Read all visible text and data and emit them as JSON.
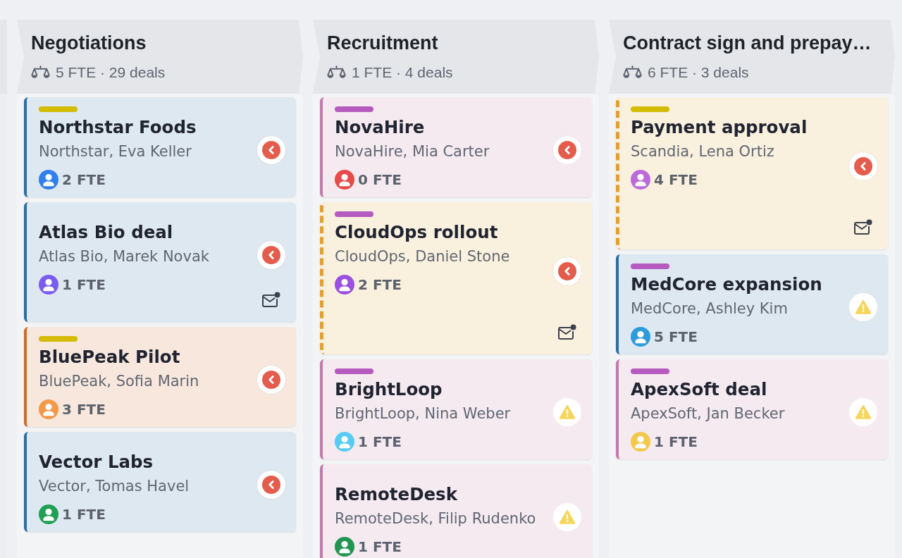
{
  "columns": [
    {
      "title": "Negotiations",
      "summary": "5 FTE · 29 deals",
      "cards": [
        {
          "title": "Northstar Foods",
          "contact": "Northstar, Eva Keller",
          "fte": "2 FTE",
          "color": "#2e6da4",
          "dashed": false,
          "tag": {
            "color": "#d4bc00"
          },
          "avatar": {
            "color": "#2f80ed"
          },
          "action": {
            "kind": "back"
          },
          "mail": false
        },
        {
          "title": "Atlas Bio deal",
          "contact": "Atlas Bio, Marek Novak",
          "fte": "1 FTE",
          "color": "#2e6da4",
          "dashed": false,
          "avatar": {
            "color": "#7b5cf0"
          },
          "action": {
            "kind": "back"
          },
          "mail": true
        },
        {
          "title": "BluePeak Pilot",
          "contact": "BluePeak, Sofia Marin",
          "fte": "3 FTE",
          "color": "#d0692a",
          "dashed": false,
          "tag": {
            "color": "#d4bc00"
          },
          "avatar": {
            "color": "#f2994a"
          },
          "action": {
            "kind": "back"
          },
          "mail": false
        },
        {
          "title": "Vector Labs",
          "contact": "Vector, Tomas Havel",
          "fte": "1 FTE",
          "color": "#2e6da4",
          "dashed": false,
          "avatar": {
            "color": "#1fa055"
          },
          "action": {
            "kind": "back"
          },
          "mail": false
        }
      ]
    },
    {
      "title": "Recruitment",
      "summary": "1 FTE · 4 deals",
      "cards": [
        {
          "title": "NovaHire",
          "contact": "NovaHire, Mia Carter",
          "fte": "0 FTE",
          "color": "#c47aa8",
          "dashed": false,
          "tag": {
            "color": "#b55bbf"
          },
          "avatar": {
            "color": "#e84a4a"
          },
          "action": {
            "kind": "back"
          },
          "mail": false
        },
        {
          "title": "CloudOps rollout",
          "contact": "CloudOps, Daniel Stone",
          "fte": "2 FTE",
          "color": "#e2a030",
          "dashed": true,
          "tag": {
            "color": "#b55bbf"
          },
          "avatar": {
            "color": "#9b51e0"
          },
          "action": {
            "kind": "back"
          },
          "mail": true
        },
        {
          "title": "BrightLoop",
          "contact": "BrightLoop, Nina Weber",
          "fte": "1 FTE",
          "color": "#c47aa8",
          "dashed": false,
          "tag": {
            "color": "#b55bbf"
          },
          "avatar": {
            "color": "#56ccf2"
          },
          "action": {
            "kind": "warning"
          },
          "mail": false
        },
        {
          "title": "RemoteDesk",
          "contact": "RemoteDesk, Filip Rudenko",
          "fte": "1 FTE",
          "color": "#c47aa8",
          "dashed": false,
          "avatar": {
            "color": "#219653"
          },
          "action": {
            "kind": "warning"
          },
          "mail": false
        }
      ]
    },
    {
      "title": "Contract sign and prepay…",
      "summary": "6 FTE · 3 deals",
      "cards": [
        {
          "title": "Payment approval",
          "contact": "Scandia, Lena Ortiz",
          "fte": "4 FTE",
          "color": "#e2a030",
          "dashed": true,
          "tag": {
            "color": "#d4bc00"
          },
          "avatar": {
            "color": "#bb6bd9"
          },
          "action": {
            "kind": "back"
          },
          "mail": true
        },
        {
          "title": "MedCore expansion",
          "contact": "MedCore, Ashley Kim",
          "fte": "5 FTE",
          "color": "#2e6da4",
          "dashed": false,
          "tag": {
            "color": "#b55bbf"
          },
          "avatar": {
            "color": "#2d9cdb"
          },
          "action": {
            "kind": "warning"
          },
          "mail": false
        },
        {
          "title": "ApexSoft deal",
          "contact": "ApexSoft, Jan Becker",
          "fte": "1 FTE",
          "color": "#c47aa8",
          "dashed": false,
          "tag": {
            "color": "#b55bbf"
          },
          "avatar": {
            "color": "#f2c94c"
          },
          "action": {
            "kind": "warning"
          },
          "mail": false
        }
      ]
    }
  ]
}
